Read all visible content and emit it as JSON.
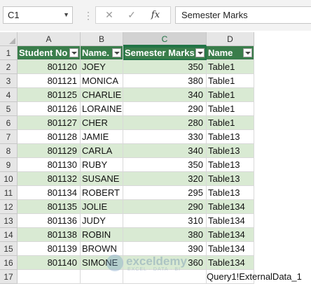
{
  "formula_bar": {
    "name_box": "C1",
    "cancel_icon": "✕",
    "enter_icon": "✓",
    "fx_label": "fx",
    "formula": "Semester Marks"
  },
  "columns": [
    "A",
    "B",
    "C",
    "D"
  ],
  "header_row": {
    "row_number": "1",
    "cells": [
      "Student No",
      "Name.",
      "Semester Marks",
      "Name"
    ]
  },
  "rows": [
    {
      "n": "2",
      "id": "801120",
      "name": "JOEY",
      "marks": "350",
      "table": "Table1"
    },
    {
      "n": "3",
      "id": "801121",
      "name": "MONICA",
      "marks": "380",
      "table": "Table1"
    },
    {
      "n": "4",
      "id": "801125",
      "name": "CHARLIE",
      "marks": "340",
      "table": "Table1"
    },
    {
      "n": "5",
      "id": "801126",
      "name": "LORAINE",
      "marks": "290",
      "table": "Table1"
    },
    {
      "n": "6",
      "id": "801127",
      "name": "CHER",
      "marks": "280",
      "table": "Table1"
    },
    {
      "n": "7",
      "id": "801128",
      "name": "JAMIE",
      "marks": "330",
      "table": "Table13"
    },
    {
      "n": "8",
      "id": "801129",
      "name": "CARLA",
      "marks": "340",
      "table": "Table13"
    },
    {
      "n": "9",
      "id": "801130",
      "name": "RUBY",
      "marks": "350",
      "table": "Table13"
    },
    {
      "n": "10",
      "id": "801132",
      "name": "SUSANE",
      "marks": "320",
      "table": "Table13"
    },
    {
      "n": "11",
      "id": "801134",
      "name": "ROBERT",
      "marks": "295",
      "table": "Table13"
    },
    {
      "n": "12",
      "id": "801135",
      "name": "JOLIE",
      "marks": "290",
      "table": "Table134"
    },
    {
      "n": "13",
      "id": "801136",
      "name": "JUDY",
      "marks": "310",
      "table": "Table134"
    },
    {
      "n": "14",
      "id": "801138",
      "name": "ROBIN",
      "marks": "380",
      "table": "Table134"
    },
    {
      "n": "15",
      "id": "801139",
      "name": "BROWN",
      "marks": "390",
      "table": "Table134"
    },
    {
      "n": "16",
      "id": "801140",
      "name": "SIMONE",
      "marks": "360",
      "table": "Table134"
    }
  ],
  "row_17": "17",
  "table_name": "Query1!ExternalData_1",
  "watermark": {
    "name": "exceldemy",
    "tagline": "EXCEL · DATA · BI"
  },
  "colors": {
    "header_green": "#3a7d4b",
    "band": "#d9ead3",
    "accent": "#217346"
  }
}
